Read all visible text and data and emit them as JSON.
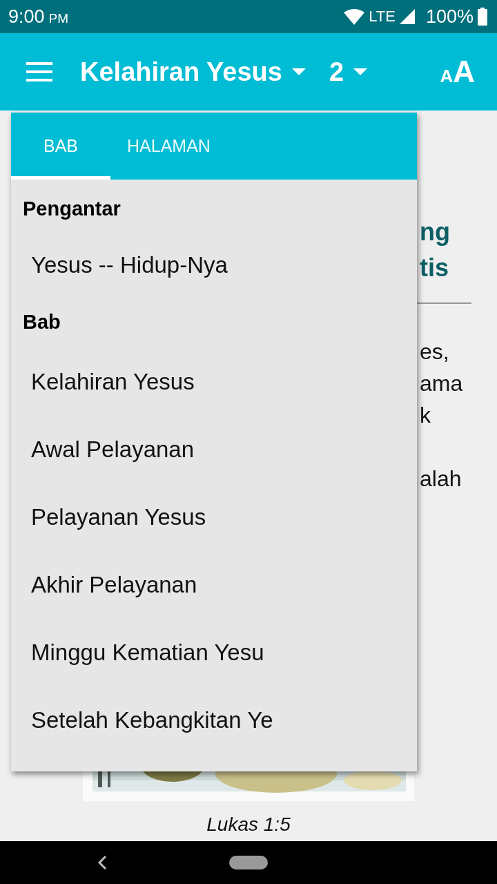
{
  "status_bar": {
    "time": "9:00",
    "ampm": "PM",
    "network": "LTE",
    "battery": "100%"
  },
  "app_bar": {
    "title": "Kelahiran Yesus",
    "chapter": "2",
    "text_size_small": "A",
    "text_size_large": "A"
  },
  "page": {
    "heading_lines": [
      "ng",
      "tis"
    ],
    "paragraphs": [
      [
        "es,",
        "ama",
        "k"
      ],
      [
        "alah"
      ]
    ],
    "caption": "Lukas 1:5"
  },
  "dropdown": {
    "tabs": [
      {
        "label": "BAB",
        "selected": true
      },
      {
        "label": "HALAMAN",
        "selected": false
      }
    ],
    "sections": [
      {
        "heading": "Pengantar",
        "items": [
          "Yesus -- Hidup-Nya"
        ]
      },
      {
        "heading": "Bab",
        "items": [
          "Kelahiran Yesus",
          "Awal Pelayanan",
          "Pelayanan Yesus",
          "Akhir Pelayanan",
          "Minggu Kematian Yesu",
          "Setelah Kebangkitan Ye"
        ]
      }
    ]
  }
}
